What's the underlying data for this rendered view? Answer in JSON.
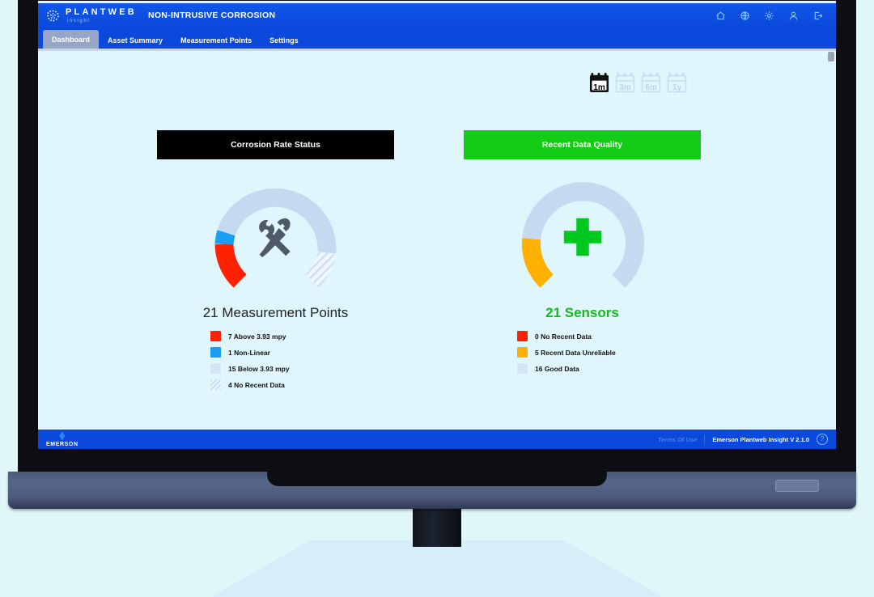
{
  "header": {
    "brand_name": "PLANTWEB",
    "brand_sub": "insight",
    "app_title": "NON-INTRUSIVE CORROSION",
    "icons": [
      {
        "name": "home-icon",
        "label": "Home"
      },
      {
        "name": "globe-icon",
        "label": "Language"
      },
      {
        "name": "gear-icon",
        "label": "Settings"
      },
      {
        "name": "user-icon",
        "label": "Account"
      },
      {
        "name": "logout-icon",
        "label": "Log Out"
      }
    ]
  },
  "tabs": [
    {
      "label": "Dashboard",
      "active": true
    },
    {
      "label": "Asset Summary",
      "active": false
    },
    {
      "label": "Measurement Points",
      "active": false
    },
    {
      "label": "Settings",
      "active": false
    }
  ],
  "time_range": {
    "options": [
      {
        "label": "1m",
        "selected": true
      },
      {
        "label": "3m",
        "selected": false
      },
      {
        "label": "6m",
        "selected": false
      },
      {
        "label": "1y",
        "selected": false
      }
    ]
  },
  "panels": [
    {
      "title": "Corrosion Rate Status",
      "bar_color": "#000000",
      "total": "21 Measurement Points",
      "icon": "tools-icon",
      "legend": [
        {
          "count": "7",
          "label": "7 Above 3.93 mpy",
          "color": "#ff2200",
          "hatch": false
        },
        {
          "count": "1",
          "label": "1 Non-Linear",
          "color": "#189ef2",
          "hatch": false
        },
        {
          "count": "15",
          "label": "15 Below 3.93 mpy",
          "color": "#d6e4f7",
          "hatch": false
        },
        {
          "count": "4",
          "label": "4 No Recent Data",
          "color": "#d6e4f7",
          "hatch": true
        }
      ]
    },
    {
      "title": "Recent Data Quality",
      "bar_color": "#13cc15",
      "total": "21 Sensors",
      "icon": "health-cross-icon",
      "legend": [
        {
          "count": "0",
          "label": "0 No Recent Data",
          "color": "#ff2200",
          "hatch": false
        },
        {
          "count": "5",
          "label": "5 Recent Data Unreliable",
          "color": "#ffb000",
          "hatch": false
        },
        {
          "count": "16",
          "label": "16 Good Data",
          "color": "#d6e4f7",
          "hatch": false
        }
      ]
    }
  ],
  "chart_data": [
    {
      "type": "pie",
      "title": "Corrosion Rate Status",
      "subtitle": "21 Measurement Points",
      "categories": [
        "Above 3.93 mpy",
        "Non-Linear",
        "Below 3.93 mpy",
        "No Recent Data"
      ],
      "values": [
        7,
        1,
        15,
        4
      ],
      "colors": [
        "#ff2200",
        "#189ef2",
        "#c5d9f1",
        "#dce8f8"
      ],
      "legend": "bottom",
      "total": 21
    },
    {
      "type": "pie",
      "title": "Recent Data Quality",
      "subtitle": "21 Sensors",
      "categories": [
        "No Recent Data",
        "Recent Data Unreliable",
        "Good Data"
      ],
      "values": [
        0,
        5,
        16
      ],
      "colors": [
        "#ff2200",
        "#ffb000",
        "#c5d9f1"
      ],
      "legend": "bottom",
      "total": 21
    }
  ],
  "footer": {
    "logo": "EMERSON",
    "terms": "Terms Of Use",
    "version": "Emerson Plantweb Insight V 2.1.0",
    "help": "?"
  }
}
